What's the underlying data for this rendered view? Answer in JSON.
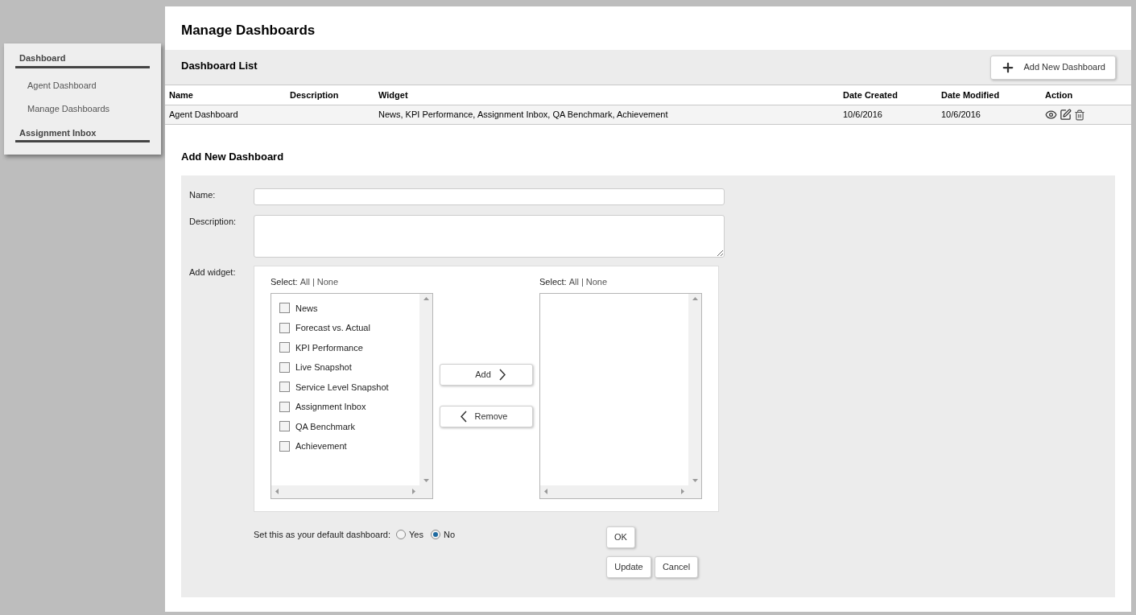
{
  "sidebar": {
    "sections": [
      {
        "title": "Dashboard",
        "items": [
          {
            "label": "Agent Dashboard"
          },
          {
            "label": "Manage Dashboards"
          }
        ]
      },
      {
        "title": "Assignment Inbox"
      }
    ]
  },
  "page": {
    "title": "Manage Dashboards"
  },
  "dashboard_list": {
    "title": "Dashboard List",
    "add_button": "Add New Dashboard",
    "columns": [
      "Name",
      "Description",
      "Widget",
      "Date Created",
      "Date Modified",
      "Action"
    ],
    "rows": [
      {
        "name": "Agent Dashboard",
        "description": "",
        "widget": "News, KPI Performance, Assignment Inbox, QA Benchmark, Achievement",
        "date_created": "10/6/2016",
        "date_modified": "10/6/2016"
      }
    ]
  },
  "form": {
    "title": "Add New Dashboard",
    "name_label": "Name:",
    "description_label": "Description:",
    "widget_label": "Add widget:",
    "left_select": {
      "label": "Select:",
      "all": "All",
      "separator": "|",
      "none": "None"
    },
    "right_select": {
      "label": "Select:",
      "all": "All",
      "separator": "|",
      "none": "None"
    },
    "available_widgets": [
      {
        "label": "News",
        "checked": false
      },
      {
        "label": "Forecast vs. Actual",
        "checked": false
      },
      {
        "label": "KPI Performance",
        "checked": false
      },
      {
        "label": "Live Snapshot",
        "checked": false
      },
      {
        "label": "Service Level Snapshot",
        "checked": false
      },
      {
        "label": "Assignment Inbox",
        "checked": false
      },
      {
        "label": "QA Benchmark",
        "checked": false
      },
      {
        "label": "Achievement",
        "checked": false
      }
    ],
    "add_button": "Add",
    "remove_button": "Remove",
    "default_label": "Set this as your default dashboard:",
    "default_options": [
      {
        "label": "Yes",
        "selected": false
      },
      {
        "label": "No",
        "selected": true
      }
    ],
    "ok_button": "OK",
    "update_button": "Update",
    "cancel_button": "Cancel"
  }
}
